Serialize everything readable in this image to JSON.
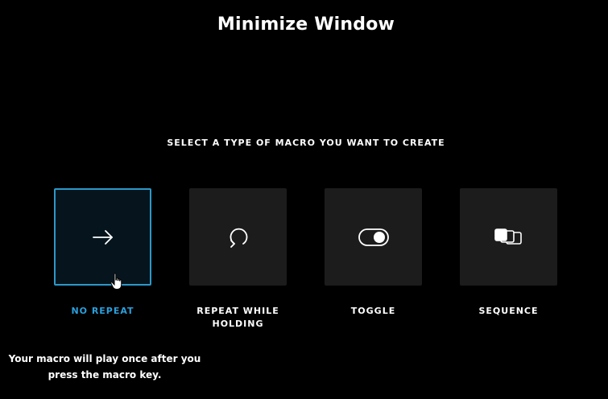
{
  "window": {
    "title": "Minimize Window"
  },
  "prompt": "SELECT A TYPE OF MACRO YOU WANT TO CREATE",
  "macro_types": [
    {
      "label": "NO REPEAT",
      "icon": "arrow-right-icon",
      "selected": true
    },
    {
      "label": "REPEAT WHILE HOLDING",
      "icon": "repeat-icon",
      "selected": false
    },
    {
      "label": "TOGGLE",
      "icon": "toggle-icon",
      "selected": false
    },
    {
      "label": "SEQUENCE",
      "icon": "sequence-icon",
      "selected": false
    }
  ],
  "description": "Your macro will play once after you press the macro key.",
  "colors": {
    "background": "#000000",
    "tile": "#1c1c1c",
    "selected_border": "#2d98c9",
    "selected_label": "#2aa0dc"
  }
}
